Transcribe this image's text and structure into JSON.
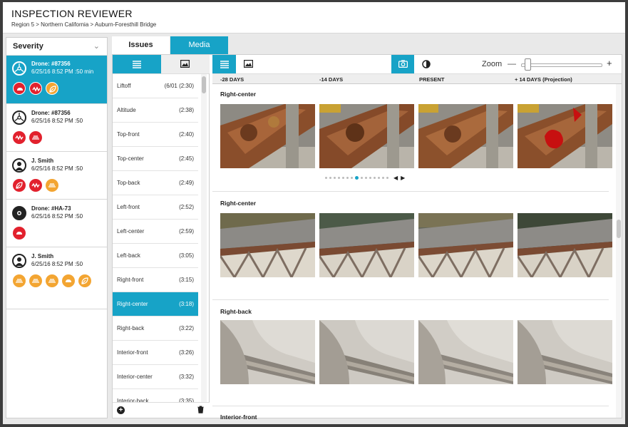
{
  "header": {
    "title": "INSPECTION REVIEWER",
    "breadcrumb": "Region 5 > Northern California > Auburn-Foresthill Bridge"
  },
  "severity": {
    "label": "Severity",
    "items": [
      {
        "who": "Drone: #87356",
        "when": "6/25/16 8:52 PM  :50 min",
        "selected": true,
        "avatar": "drone-icon",
        "severity_icons": [
          "corrosion-icon",
          "crack-icon",
          "vegetation-icon"
        ]
      },
      {
        "who": "Drone: #87356",
        "when": "6/25/16 8:52 PM  :50",
        "selected": false,
        "avatar": "drone-icon",
        "severity_icons": [
          "crack-icon",
          "spalling-icon"
        ]
      },
      {
        "who": "J. Smith",
        "when": "6/25/16 8:52 PM  :50",
        "selected": false,
        "avatar": "person-icon",
        "severity_icons": [
          "vegetation-icon",
          "crack-icon",
          "spalling-icon"
        ]
      },
      {
        "who": "Drone: #HA-73",
        "when": "6/25/16 8:52 PM  :50",
        "selected": false,
        "avatar": "gear-drone-icon",
        "severity_icons": [
          "corrosion-icon"
        ]
      },
      {
        "who": "J. Smith",
        "when": "6/25/16 8:52 PM  :50",
        "selected": false,
        "avatar": "person-icon",
        "severity_icons": [
          "spalling-icon",
          "spalling-icon",
          "spalling-icon",
          "corrosion-icon",
          "vegetation-icon"
        ]
      }
    ]
  },
  "tabs": {
    "issues": "Issues",
    "media": "Media"
  },
  "views": [
    {
      "name": "Liftoff",
      "time": "(6/01   (2:30)"
    },
    {
      "name": "Altitude",
      "time": "(2:38)"
    },
    {
      "name": "Top-front",
      "time": "(2:40)"
    },
    {
      "name": "Top-center",
      "time": "(2:45)"
    },
    {
      "name": "Top-back",
      "time": "(2:49)"
    },
    {
      "name": "Left-front",
      "time": "(2:52)"
    },
    {
      "name": "Left-center",
      "time": "(2:59)"
    },
    {
      "name": "Left-back",
      "time": "(3:05)"
    },
    {
      "name": "Right-front",
      "time": "(3:15)"
    },
    {
      "name": "Right-center",
      "time": "(3:18)",
      "selected": true
    },
    {
      "name": "Right-back",
      "time": "(3:22)"
    },
    {
      "name": "Interior-front",
      "time": "(3:26)"
    },
    {
      "name": "Interior-center",
      "time": "(3:32)"
    },
    {
      "name": "Interior-back",
      "time": "(3:35)"
    }
  ],
  "gallery": {
    "zoom_label": "Zoom",
    "zoom_minus": "—",
    "zoom_plus": "+",
    "zoom_level": 0.05,
    "timeline": [
      "-28 DAYS",
      "-14 DAYS",
      "PRESENT",
      "+ 14 DAYS (Projection)"
    ],
    "sections": [
      "Right-center",
      "Right-center",
      "Right-back",
      "Interior-front"
    ],
    "pager_active_index": 7,
    "pager_count": 15
  },
  "colors": {
    "accent": "#17a3c7",
    "severity_high": "#e2212d",
    "severity_med": "#f3a532"
  }
}
